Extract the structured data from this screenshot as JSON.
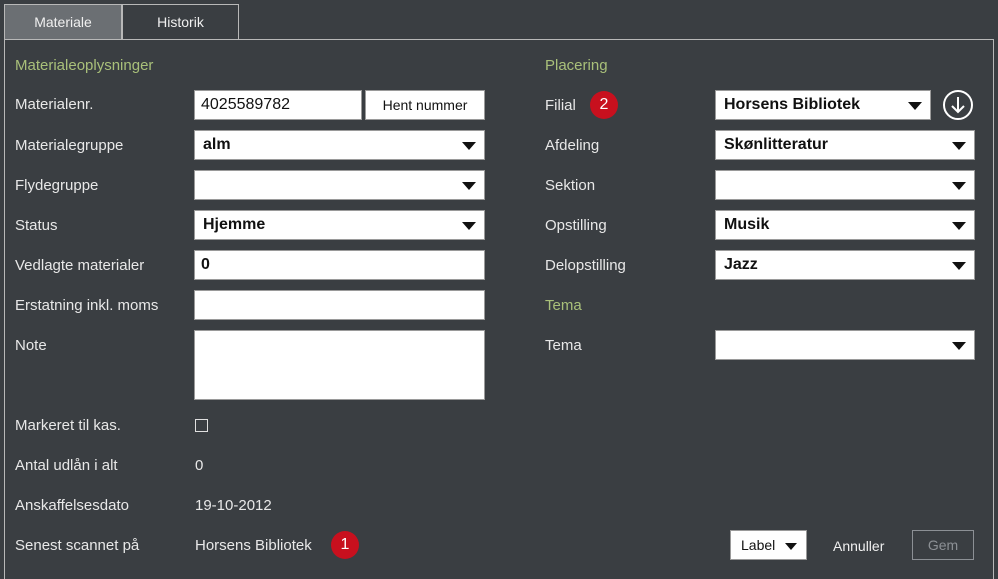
{
  "tabs": [
    {
      "label": "Materiale",
      "active": true
    },
    {
      "label": "Historik",
      "active": false
    }
  ],
  "left": {
    "title": "Materialeoplysninger",
    "materialenr": {
      "label": "Materialenr.",
      "value": "4025589782",
      "button": "Hent nummer"
    },
    "materialegruppe": {
      "label": "Materialegruppe",
      "value": "alm"
    },
    "flydegruppe": {
      "label": "Flydegruppe",
      "value": ""
    },
    "status": {
      "label": "Status",
      "value": "Hjemme"
    },
    "vedlagte": {
      "label": "Vedlagte materialer",
      "value": "0"
    },
    "erstatning": {
      "label": "Erstatning inkl. moms",
      "value": ""
    },
    "note": {
      "label": "Note",
      "value": ""
    },
    "markeret": {
      "label": "Markeret til kas.",
      "checked": false
    },
    "antal": {
      "label": "Antal udlån i alt",
      "value": "0"
    },
    "anskaffelse": {
      "label": "Anskaffelsesdato",
      "value": "19-10-2012"
    },
    "scannet": {
      "label": "Senest scannet på",
      "value": "Horsens Bibliotek",
      "badge": "1"
    }
  },
  "right": {
    "placering_title": "Placering",
    "filial": {
      "label": "Filial",
      "value": "Horsens Bibliotek",
      "badge": "2",
      "icon": "arrow-down-circle-icon"
    },
    "afdeling": {
      "label": "Afdeling",
      "value": "Skønlitteratur"
    },
    "sektion": {
      "label": "Sektion",
      "value": ""
    },
    "opstilling": {
      "label": "Opstilling",
      "value": "Musik"
    },
    "delopstilling": {
      "label": "Delopstilling",
      "value": "Jazz"
    },
    "tema_title": "Tema",
    "tema": {
      "label": "Tema",
      "value": ""
    }
  },
  "footer": {
    "label_button": "Label",
    "cancel": "Annuller",
    "save": "Gem"
  },
  "colors": {
    "background": "#3a3e42",
    "section_title": "#a9c07a",
    "badge": "#c8101e"
  }
}
